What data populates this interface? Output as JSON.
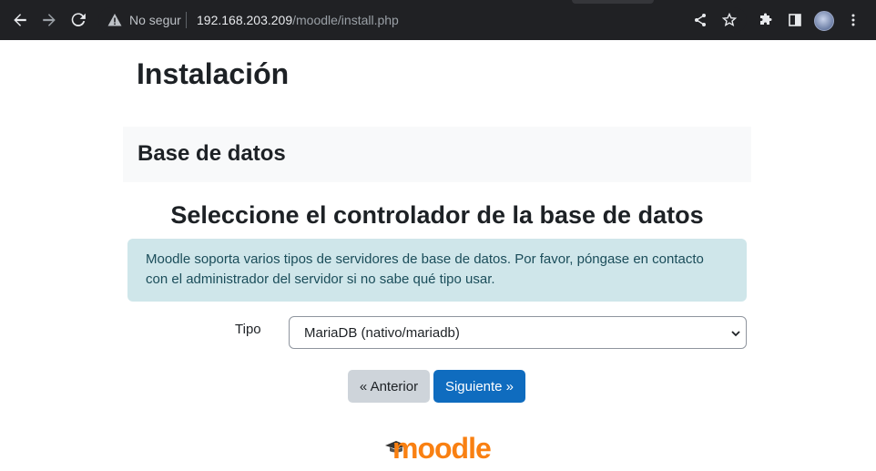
{
  "browser": {
    "security_label": "No segur",
    "url_host": "192.168.203.209",
    "url_path": "/moodle/install.php",
    "icons": [
      "back-arrow-icon",
      "forward-arrow-icon",
      "reload-icon",
      "warning-icon",
      "share-icon",
      "star-icon",
      "extensions-icon",
      "sidepanel-icon",
      "profile-avatar",
      "menu-icon"
    ]
  },
  "page": {
    "title": "Instalación",
    "section": "Base de datos",
    "subtitle": "Seleccione el controlador de la base de datos",
    "info": "Moodle soporta varios tipos de servidores de base de datos. Por favor, póngase en contacto con el administrador del servidor si no sabe qué tipo usar.",
    "field_label": "Tipo",
    "select_value": "MariaDB (nativo/mariadb)",
    "prev_button": "« Anterior",
    "next_button": "Siguiente »",
    "logo_text": "moodle"
  },
  "colors": {
    "chrome_bg": "#202124",
    "alert_bg": "#cfe6ea",
    "primary": "#0f6cbf",
    "secondary": "#ced4da",
    "logo": "#f98012"
  }
}
